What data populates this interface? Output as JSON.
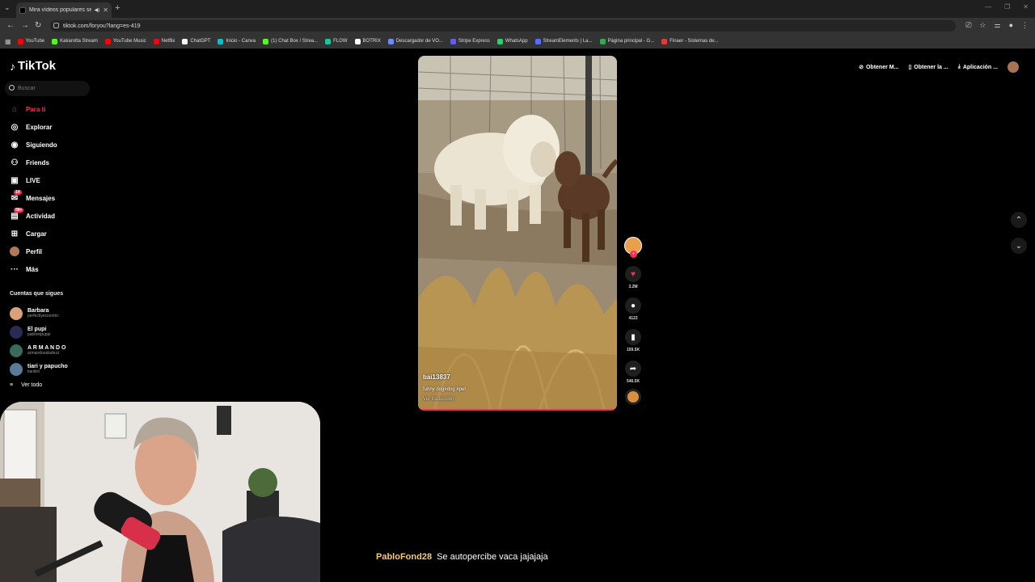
{
  "browser": {
    "tab_title": "Mira vídeos populares selec",
    "url": "tiktok.com/foryou?lang=es-419",
    "bookmarks": [
      {
        "label": "YouTube",
        "color": "#ff0000"
      },
      {
        "label": "Kakarotta Stream",
        "color": "#53fc18"
      },
      {
        "label": "YouTube Music",
        "color": "#ff0000"
      },
      {
        "label": "Netflix",
        "color": "#e50914"
      },
      {
        "label": "ChatGPT",
        "color": "#ffffff"
      },
      {
        "label": "Inicio - Canva",
        "color": "#00c4cc"
      },
      {
        "label": "(1) Chat Box / Strea...",
        "color": "#53fc18"
      },
      {
        "label": "FLOW",
        "color": "#14c8a0"
      },
      {
        "label": "BOTRIX",
        "color": "#ffffff"
      },
      {
        "label": "Descargador de VO...",
        "color": "#6a8cff"
      },
      {
        "label": "Stripe Express",
        "color": "#635bff"
      },
      {
        "label": "WhatsApp",
        "color": "#25d366"
      },
      {
        "label": "StreamElements | La...",
        "color": "#5a6cff"
      },
      {
        "label": "Página principal - G...",
        "color": "#34a853"
      },
      {
        "label": "Finaer - Sistemas de...",
        "color": "#e53935"
      }
    ]
  },
  "tiktok": {
    "logo": "TikTok",
    "search_placeholder": "Buscar",
    "nav": [
      {
        "label": "Para ti",
        "icon": "home-icon",
        "active": true
      },
      {
        "label": "Explorar",
        "icon": "compass-icon"
      },
      {
        "label": "Siguiendo",
        "icon": "following-icon"
      },
      {
        "label": "Friends",
        "icon": "friends-icon"
      },
      {
        "label": "LIVE",
        "icon": "live-icon"
      },
      {
        "label": "Mensajes",
        "icon": "messages-icon",
        "badge": "14"
      },
      {
        "label": "Actividad",
        "icon": "activity-icon",
        "badge": "99+"
      },
      {
        "label": "Cargar",
        "icon": "upload-icon"
      },
      {
        "label": "Perfil",
        "icon": "profile-avatar"
      },
      {
        "label": "Más",
        "icon": "more-icon"
      }
    ],
    "following_title": "Cuentas que sigues",
    "following": [
      {
        "name": "Barbara",
        "user": "perfectlyeccentric",
        "color": "#d9a07a"
      },
      {
        "name": "El pupi",
        "user": "pabloelpuppi",
        "color": "#2a2a55"
      },
      {
        "name": "A R M A N D O",
        "user": "armandovaladezz",
        "color": "#3a6a5a"
      },
      {
        "name": "tiari y papucho",
        "user": "tiariiiiiii",
        "color": "#5a7a9a"
      }
    ],
    "see_all": "Ver todo",
    "top_right": [
      "Obtener M...",
      "Obtener la ...",
      "Aplicación ..."
    ],
    "video": {
      "author": "bai13837",
      "description": "funny dog#dog #pet",
      "translate": "Ver traducción",
      "progress": 0.99
    },
    "actions": {
      "likes": "3.2M",
      "comments": "4123",
      "saves": "159.5K",
      "shares": "546.5K"
    }
  },
  "chat": {
    "user": "PabloFond28",
    "message": "Se autopercibe vaca jajajaja"
  }
}
